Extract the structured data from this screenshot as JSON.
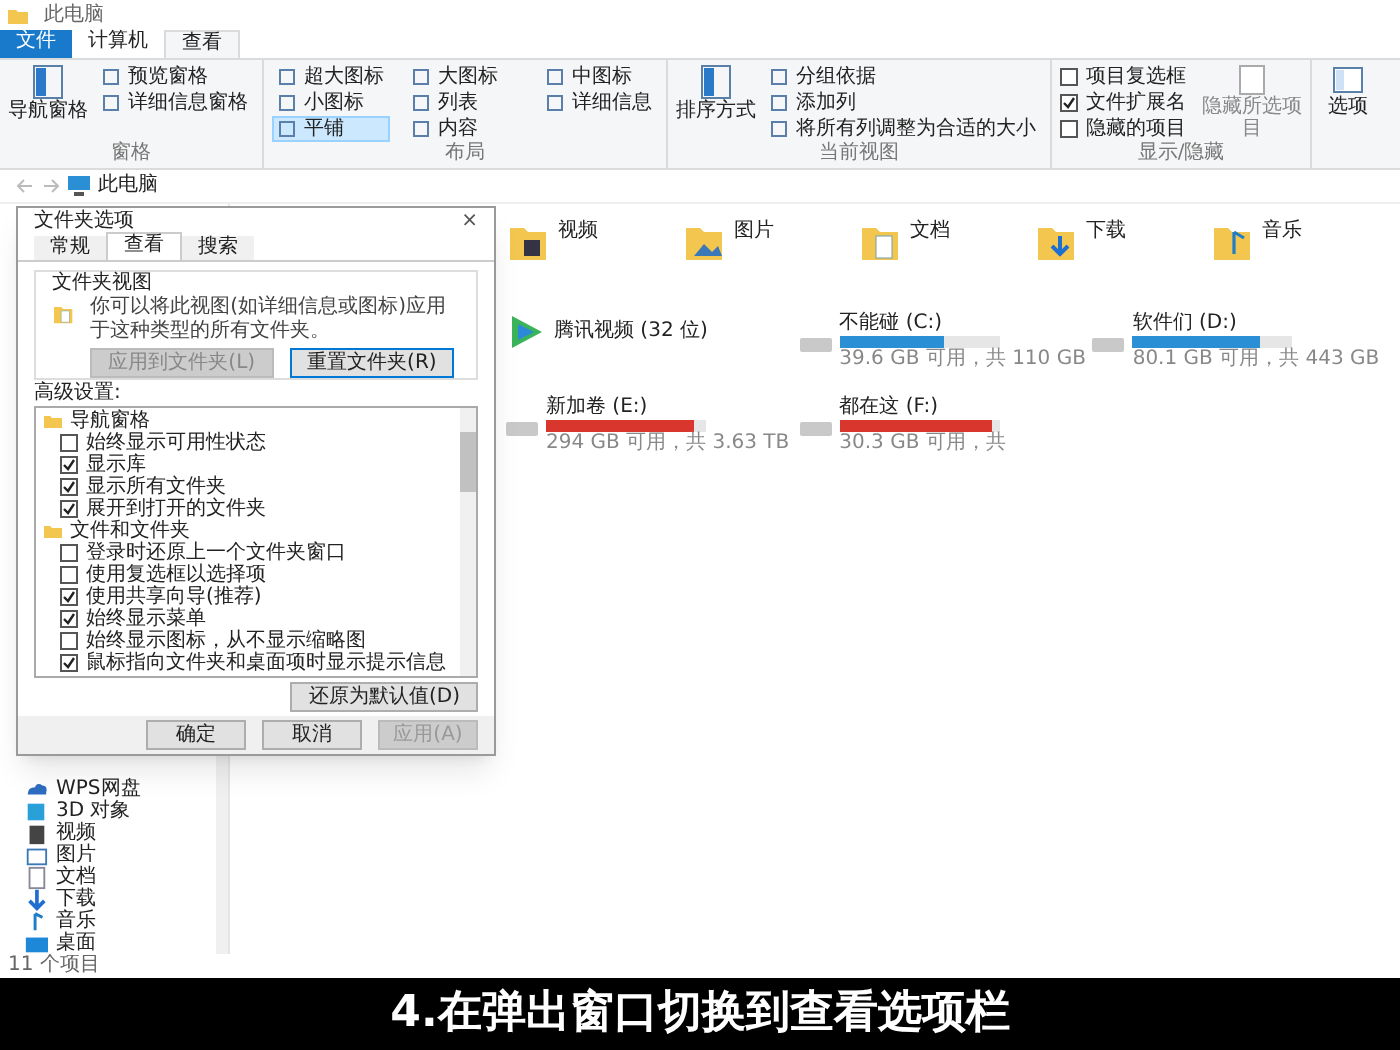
{
  "window": {
    "title": "此电脑"
  },
  "ribbon_tabs": [
    {
      "label": "文件",
      "selected": false,
      "kind": "file"
    },
    {
      "label": "计算机",
      "selected": false,
      "kind": "tab"
    },
    {
      "label": "查看",
      "selected": true,
      "kind": "tab"
    }
  ],
  "ribbon_groups": [
    {
      "label": "窗格",
      "big": [
        {
          "label": "导航窗格"
        }
      ],
      "items": [
        {
          "label": "预览窗格",
          "selected": false
        },
        {
          "label": "详细信息窗格",
          "selected": false
        }
      ]
    },
    {
      "label": "布局",
      "items": [
        {
          "label": "超大图标",
          "selected": false
        },
        {
          "label": "大图标",
          "selected": false
        },
        {
          "label": "中图标",
          "selected": false
        },
        {
          "label": "小图标",
          "selected": false
        },
        {
          "label": "列表",
          "selected": false
        },
        {
          "label": "详细信息",
          "selected": false
        },
        {
          "label": "平铺",
          "selected": true
        },
        {
          "label": "内容",
          "selected": false
        }
      ]
    },
    {
      "label": "当前视图",
      "big": [
        {
          "label": "排序方式"
        }
      ],
      "items": [
        {
          "label": "分组依据",
          "selected": false
        },
        {
          "label": "添加列",
          "selected": false
        },
        {
          "label": "将所有列调整为合适的大小",
          "selected": false
        }
      ]
    }
  ],
  "show_hide": {
    "label": "显示/隐藏",
    "checks": [
      {
        "label": "项目复选框",
        "checked": false
      },
      {
        "label": "文件扩展名",
        "checked": true
      },
      {
        "label": "隐藏的项目",
        "checked": false
      }
    ],
    "hide_button": "隐藏所选项目"
  },
  "options_button": "选项",
  "address": "此电脑",
  "folders": [
    {
      "name": "视频",
      "kind": "video"
    },
    {
      "name": "图片",
      "kind": "picture"
    },
    {
      "name": "文档",
      "kind": "document"
    },
    {
      "name": "下载",
      "kind": "download"
    },
    {
      "name": "音乐",
      "kind": "music"
    }
  ],
  "app_item": {
    "name": "腾讯视频 (32 位)"
  },
  "drives": [
    {
      "name": "不能碰 (C:)",
      "level": 0.65,
      "color": "#2b8fd6",
      "space": "39.6 GB 可用，共 110 GB"
    },
    {
      "name": "软件们 (D:)",
      "level": 0.8,
      "color": "#2b8fd6",
      "space": "80.1 GB 可用，共 443 GB"
    },
    {
      "name": "新加卷 (E:)",
      "level": 0.92,
      "color": "#d9372e",
      "space": "294 GB 可用，共 3.63 TB"
    },
    {
      "name": "都在这 (F:)",
      "level": 0.95,
      "color": "#d9372e",
      "space": "30.3 GB 可用，共"
    }
  ],
  "sidebar": {
    "items": [
      {
        "label": "WPS网盘",
        "kind": "cloud"
      },
      {
        "label": "3D 对象",
        "kind": "cube"
      },
      {
        "label": "视频",
        "kind": "video"
      },
      {
        "label": "图片",
        "kind": "picture"
      },
      {
        "label": "文档",
        "kind": "document"
      },
      {
        "label": "下载",
        "kind": "download"
      },
      {
        "label": "音乐",
        "kind": "music"
      },
      {
        "label": "桌面",
        "kind": "desktop"
      }
    ]
  },
  "status_bar": "11 个项目",
  "dialog": {
    "title": "文件夹选项",
    "close": "×",
    "tabs": [
      {
        "label": "常规",
        "selected": false
      },
      {
        "label": "查看",
        "selected": true
      },
      {
        "label": "搜索",
        "selected": false
      }
    ],
    "folder_view": {
      "label": "文件夹视图",
      "text": "你可以将此视图(如详细信息或图标)应用于这种类型的所有文件夹。",
      "buttons": [
        {
          "label": "应用到文件夹(L)",
          "disabled": true
        },
        {
          "label": "重置文件夹(R)",
          "disabled": false
        }
      ]
    },
    "advanced_label": "高级设置:",
    "tree": [
      {
        "label": "导航窗格",
        "children": [
          {
            "label": "始终显示可用性状态",
            "checked": false
          },
          {
            "label": "显示库",
            "checked": true
          },
          {
            "label": "显示所有文件夹",
            "checked": true
          },
          {
            "label": "展开到打开的文件夹",
            "checked": true
          }
        ]
      },
      {
        "label": "文件和文件夹",
        "children": [
          {
            "label": "登录时还原上一个文件夹窗口",
            "checked": false
          },
          {
            "label": "使用复选框以选择项",
            "checked": false
          },
          {
            "label": "使用共享向导(推荐)",
            "checked": true
          },
          {
            "label": "始终显示菜单",
            "checked": true
          },
          {
            "label": "始终显示图标，从不显示缩略图",
            "checked": false
          },
          {
            "label": "鼠标指向文件夹和桌面项时显示提示信息",
            "checked": true
          }
        ]
      }
    ],
    "restore_button": "还原为默认值(D)",
    "buttons": [
      {
        "label": "确定",
        "disabled": false
      },
      {
        "label": "取消",
        "disabled": false
      },
      {
        "label": "应用(A)",
        "disabled": true
      }
    ]
  },
  "caption": "4.在弹出窗口切换到查看选项栏"
}
